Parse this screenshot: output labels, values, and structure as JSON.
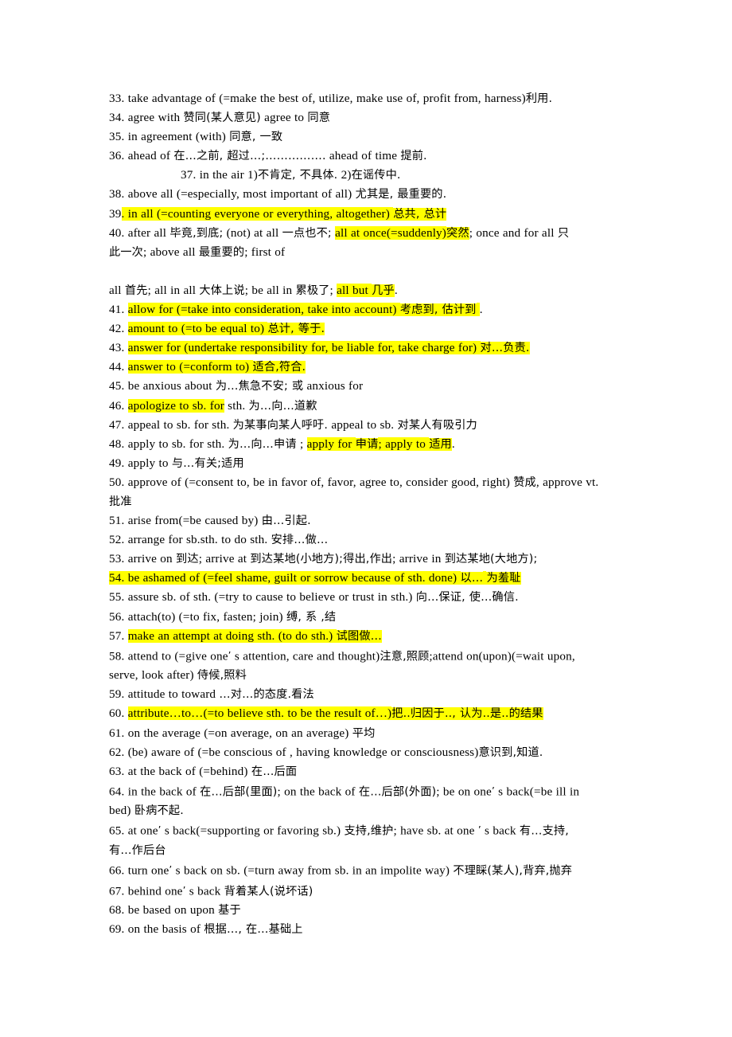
{
  "document": {
    "type": "english-phrase-vocabulary-list",
    "page_background": "#ffffff",
    "highlight_color": "#ffff00",
    "text_color": "#000000",
    "entries": [
      {
        "number": "33.",
        "lines": [
          [
            {
              "t": "33. take advantage of (=make the best of, utilize, make use of, profit from, harness)",
              "h": false
            },
            {
              "t": "利用.",
              "h": false,
              "cjk": true
            }
          ]
        ]
      },
      {
        "number": "34.",
        "lines": [
          [
            {
              "t": "34. agree with  ",
              "h": false
            },
            {
              "t": "赞同(某人意见)",
              "h": false,
              "cjk": true
            },
            {
              "t": " agree to  ",
              "h": false
            },
            {
              "t": "同意",
              "h": false,
              "cjk": true
            }
          ]
        ]
      },
      {
        "number": "35.",
        "lines": [
          [
            {
              "t": "35. in agreement (with)  ",
              "h": false
            },
            {
              "t": "同意, 一致",
              "h": false,
              "cjk": true
            }
          ]
        ]
      },
      {
        "number": "36.",
        "lines": [
          [
            {
              "t": "36. ahead of  ",
              "h": false
            },
            {
              "t": "在…之前, 超过…;…………….",
              "h": false,
              "cjk": true
            },
            {
              "t": " ahead of time  ",
              "h": false
            },
            {
              "t": "提前.",
              "h": false,
              "cjk": true
            }
          ]
        ]
      },
      {
        "number": "37.",
        "indent": true,
        "lines": [
          [
            {
              "t": "37. in the air 1)",
              "h": false
            },
            {
              "t": "不肯定, 不具体.",
              "h": false,
              "cjk": true
            },
            {
              "t": " 2)",
              "h": false
            },
            {
              "t": "在谣传中.",
              "h": false,
              "cjk": true
            }
          ]
        ]
      },
      {
        "number": "38.",
        "lines": [
          [
            {
              "t": "38. above all (=especially, most important of all)  ",
              "h": false
            },
            {
              "t": "尤其是, 最重要的.",
              "h": false,
              "cjk": true
            }
          ]
        ]
      },
      {
        "number": "39.",
        "lines": [
          [
            {
              "t": "39",
              "h": false
            },
            {
              "t": ". in all (=counting everyone or everything, altogether)  ",
              "h": true
            },
            {
              "t": "总共, 总计",
              "h": true,
              "cjk": true
            }
          ]
        ]
      },
      {
        "number": "40.",
        "lines": [
          [
            {
              "t": "40. after all  ",
              "h": false
            },
            {
              "t": "毕竟,到底;",
              "h": false,
              "cjk": true
            },
            {
              "t": " (not) at all  ",
              "h": false
            },
            {
              "t": "一点也不;",
              "h": false,
              "cjk": true
            },
            {
              "t": "   ",
              "h": false
            },
            {
              "t": "all at once(=suddenly)",
              "h": true
            },
            {
              "t": "突然",
              "h": true,
              "cjk": true
            },
            {
              "t": "; once and for all  ",
              "h": false
            },
            {
              "t": "只",
              "h": false,
              "cjk": true
            }
          ],
          [
            {
              "t": "此一次",
              "h": false,
              "cjk": true
            },
            {
              "t": "; above all  ",
              "h": false
            },
            {
              "t": "最重要的",
              "h": false,
              "cjk": true
            },
            {
              "t": "; first of",
              "h": false
            }
          ]
        ]
      },
      {
        "number": "",
        "blank_before": true,
        "lines": [
          [
            {
              "t": "all  ",
              "h": false
            },
            {
              "t": "首先",
              "h": false,
              "cjk": true
            },
            {
              "t": "; all in all  ",
              "h": false
            },
            {
              "t": "大体上说",
              "h": false,
              "cjk": true
            },
            {
              "t": "; be all in  ",
              "h": false
            },
            {
              "t": "累极了",
              "h": false,
              "cjk": true
            },
            {
              "t": "; ",
              "h": false
            },
            {
              "t": "all but  ",
              "h": true
            },
            {
              "t": "几乎",
              "h": true,
              "cjk": true
            },
            {
              "t": ".",
              "h": false
            }
          ]
        ]
      },
      {
        "number": "41.",
        "lines": [
          [
            {
              "t": "41. ",
              "h": false
            },
            {
              "t": "allow for (=take into consideration, take into account)  ",
              "h": true
            },
            {
              "t": "考虑到, 估计到",
              "h": true,
              "cjk": true
            },
            {
              "t": "  ",
              "h": true
            },
            {
              "t": "  .",
              "h": false
            }
          ]
        ]
      },
      {
        "number": "42.",
        "lines": [
          [
            {
              "t": "42. ",
              "h": false
            },
            {
              "t": "amount to (=to be equal to)  ",
              "h": true
            },
            {
              "t": "总计, 等于.",
              "h": true,
              "cjk": true
            }
          ]
        ]
      },
      {
        "number": "43.",
        "lines": [
          [
            {
              "t": "43. ",
              "h": false
            },
            {
              "t": "answer for (undertake responsibility for, be liable for, take charge for)  ",
              "h": true
            },
            {
              "t": "对…负责.",
              "h": true,
              "cjk": true
            }
          ]
        ]
      },
      {
        "number": "44.",
        "lines": [
          [
            {
              "t": "44. ",
              "h": false
            },
            {
              "t": "answer to (=conform to)  ",
              "h": true
            },
            {
              "t": "适合,符合.",
              "h": true,
              "cjk": true
            }
          ]
        ]
      },
      {
        "number": "45.",
        "lines": [
          [
            {
              "t": "45. be anxious about  ",
              "h": false
            },
            {
              "t": "为…焦急不安; 或",
              "h": false,
              "cjk": true
            },
            {
              "t": " anxious for",
              "h": false
            }
          ]
        ]
      },
      {
        "number": "46.",
        "lines": [
          [
            {
              "t": "46. ",
              "h": false
            },
            {
              "t": "apologize to sb. for",
              "h": true
            },
            {
              "t": " sth.  ",
              "h": false
            },
            {
              "t": "为…向…道歉",
              "h": false,
              "cjk": true
            }
          ]
        ]
      },
      {
        "number": "47.",
        "lines": [
          [
            {
              "t": "47. appeal to sb. for sth.  ",
              "h": false
            },
            {
              "t": "为某事向某人呼吁.",
              "h": false,
              "cjk": true
            },
            {
              "t": " appeal to sb.  ",
              "h": false
            },
            {
              "t": "对某人有吸引力",
              "h": false,
              "cjk": true
            }
          ]
        ]
      },
      {
        "number": "48.",
        "lines": [
          [
            {
              "t": "48. apply to sb. for sth.  ",
              "h": false
            },
            {
              "t": "为…向…申请",
              "h": false,
              "cjk": true
            },
            {
              "t": "  ; ",
              "h": false
            },
            {
              "t": "apply for ",
              "h": true
            },
            {
              "t": "申请",
              "h": true,
              "cjk": true
            },
            {
              "t": "; apply to  ",
              "h": true
            },
            {
              "t": "适用",
              "h": true,
              "cjk": true
            },
            {
              "t": ".",
              "h": false
            }
          ]
        ]
      },
      {
        "number": "49.",
        "lines": [
          [
            {
              "t": "49. apply to  ",
              "h": false
            },
            {
              "t": "与…有关;适用",
              "h": false,
              "cjk": true
            }
          ]
        ]
      },
      {
        "number": "50.",
        "lines": [
          [
            {
              "t": "50. approve of (=consent to, be in favor of, favor, agree to, consider good, right)  ",
              "h": false
            },
            {
              "t": "赞成",
              "h": false,
              "cjk": true
            },
            {
              "t": ", approve vt.",
              "h": false
            }
          ],
          [
            {
              "t": "批准",
              "h": false,
              "cjk": true
            }
          ]
        ]
      },
      {
        "number": "51.",
        "lines": [
          [
            {
              "t": "51. arise from(=be caused by)  ",
              "h": false
            },
            {
              "t": "由…引起.",
              "h": false,
              "cjk": true
            }
          ]
        ]
      },
      {
        "number": "52.",
        "lines": [
          [
            {
              "t": "52. arrange for sb.sth. to do sth.  ",
              "h": false
            },
            {
              "t": "安排…做…",
              "h": false,
              "cjk": true
            }
          ]
        ]
      },
      {
        "number": "53.",
        "lines": [
          [
            {
              "t": "53. arrive on  ",
              "h": false
            },
            {
              "t": "到达",
              "h": false,
              "cjk": true
            },
            {
              "t": "; arrive at  ",
              "h": false
            },
            {
              "t": "到达某地(小地方);得出,作出",
              "h": false,
              "cjk": true
            },
            {
              "t": "; arrive in  ",
              "h": false
            },
            {
              "t": "到达某地(大地方);",
              "h": false,
              "cjk": true
            }
          ]
        ]
      },
      {
        "number": "54.",
        "lines": [
          [
            {
              "t": "54. be ashamed of (=feel shame, guilt or sorrow because of sth. done)  ",
              "h": true
            },
            {
              "t": "以…",
              "h": true,
              "cjk": true
            },
            {
              "t": "    ",
              "h": true
            },
            {
              "t": "为羞耻",
              "h": true,
              "cjk": true
            }
          ]
        ]
      },
      {
        "number": "55.",
        "lines": [
          [
            {
              "t": "55. assure sb. of sth. (=try to cause to believe or trust in sth.)  ",
              "h": false
            },
            {
              "t": "向…保证, 使…确信.",
              "h": false,
              "cjk": true
            }
          ]
        ]
      },
      {
        "number": "56.",
        "lines": [
          [
            {
              "t": "56. attach(to) (=to fix, fasten; join)  ",
              "h": false
            },
            {
              "t": "缚, 系 ,结",
              "h": false,
              "cjk": true
            }
          ]
        ]
      },
      {
        "number": "57.",
        "lines": [
          [
            {
              "t": "57. ",
              "h": false
            },
            {
              "t": "make an attempt at doing sth. (to do sth.)  ",
              "h": true
            },
            {
              "t": "试图做…",
              "h": true,
              "cjk": true
            }
          ]
        ]
      },
      {
        "number": "58.",
        "lines": [
          [
            {
              "t": "58. attend to (=give one",
              "h": false
            },
            {
              "t": "’",
              "h": false,
              "ap": true
            },
            {
              "t": " s attention, care and thought)",
              "h": false
            },
            {
              "t": "注意,照顾",
              "h": false,
              "cjk": true
            },
            {
              "t": ";attend on(upon)(=wait upon,",
              "h": false
            }
          ],
          [
            {
              "t": "serve, look after)  ",
              "h": false
            },
            {
              "t": "侍候,照料",
              "h": false,
              "cjk": true
            }
          ]
        ]
      },
      {
        "number": "59.",
        "lines": [
          [
            {
              "t": "59. attitude to toward  ",
              "h": false
            },
            {
              "t": "…对…的态度.看法",
              "h": false,
              "cjk": true
            }
          ]
        ]
      },
      {
        "number": "60.",
        "lines": [
          [
            {
              "t": "60. ",
              "h": false
            },
            {
              "t": "attribute…to…(=to believe sth. to be the result of…)",
              "h": true
            },
            {
              "t": "把..归因于.., 认为..是..的结果",
              "h": true,
              "cjk": true
            }
          ]
        ]
      },
      {
        "number": "61.",
        "lines": [
          [
            {
              "t": "61. on the average (=on average, on an average)  ",
              "h": false
            },
            {
              "t": "平均",
              "h": false,
              "cjk": true
            }
          ]
        ]
      },
      {
        "number": "62.",
        "lines": [
          [
            {
              "t": "62. (be) aware of (=be conscious of , having knowledge or consciousness)",
              "h": false
            },
            {
              "t": "意识到,知道.",
              "h": false,
              "cjk": true
            }
          ]
        ]
      },
      {
        "number": "63.",
        "lines": [
          [
            {
              "t": "63. at the back of (=behind)  ",
              "h": false
            },
            {
              "t": "在…后面",
              "h": false,
              "cjk": true
            }
          ]
        ]
      },
      {
        "number": "64.",
        "lines": [
          [
            {
              "t": "64. in the back of  ",
              "h": false
            },
            {
              "t": "在…后部(里面)",
              "h": false,
              "cjk": true
            },
            {
              "t": "; on the back of  ",
              "h": false
            },
            {
              "t": "在…后部(外面)",
              "h": false,
              "cjk": true
            },
            {
              "t": "; be on one",
              "h": false
            },
            {
              "t": "’",
              "h": false,
              "ap": true
            },
            {
              "t": " s back(=be ill in",
              "h": false
            }
          ],
          [
            {
              "t": "bed)  ",
              "h": false
            },
            {
              "t": "卧病不起.",
              "h": false,
              "cjk": true
            }
          ]
        ]
      },
      {
        "number": "65.",
        "lines": [
          [
            {
              "t": "65. at one",
              "h": false
            },
            {
              "t": "’",
              "h": false,
              "ap": true
            },
            {
              "t": " s back(=supporting or favoring sb.)  ",
              "h": false
            },
            {
              "t": "支持,维护",
              "h": false,
              "cjk": true
            },
            {
              "t": "; have sb. at one  ",
              "h": false
            },
            {
              "t": "’",
              "h": false,
              "ap": true
            },
            {
              "t": " s back  ",
              "h": false
            },
            {
              "t": "有…支持,",
              "h": false,
              "cjk": true
            }
          ],
          [
            {
              "t": "有…作后台",
              "h": false,
              "cjk": true
            }
          ]
        ]
      },
      {
        "number": "66.",
        "lines": [
          [
            {
              "t": "66. turn one",
              "h": false
            },
            {
              "t": "’",
              "h": false,
              "ap": true
            },
            {
              "t": " s back on sb. (=turn away from sb. in an impolite way)  ",
              "h": false
            },
            {
              "t": "不理睬(某人),背弃,抛弃",
              "h": false,
              "cjk": true
            }
          ]
        ]
      },
      {
        "number": "67.",
        "lines": [
          [
            {
              "t": "67. behind one",
              "h": false
            },
            {
              "t": "’",
              "h": false,
              "ap": true
            },
            {
              "t": " s back  ",
              "h": false
            },
            {
              "t": "背着某人(说坏话)",
              "h": false,
              "cjk": true
            }
          ]
        ]
      },
      {
        "number": "68.",
        "lines": [
          [
            {
              "t": "68. be based on   upon  ",
              "h": false
            },
            {
              "t": "基于",
              "h": false,
              "cjk": true
            }
          ]
        ]
      },
      {
        "number": "69.",
        "lines": [
          [
            {
              "t": "69. on the basis of  ",
              "h": false
            },
            {
              "t": "根据…, 在…基础上",
              "h": false,
              "cjk": true
            }
          ]
        ]
      }
    ]
  }
}
